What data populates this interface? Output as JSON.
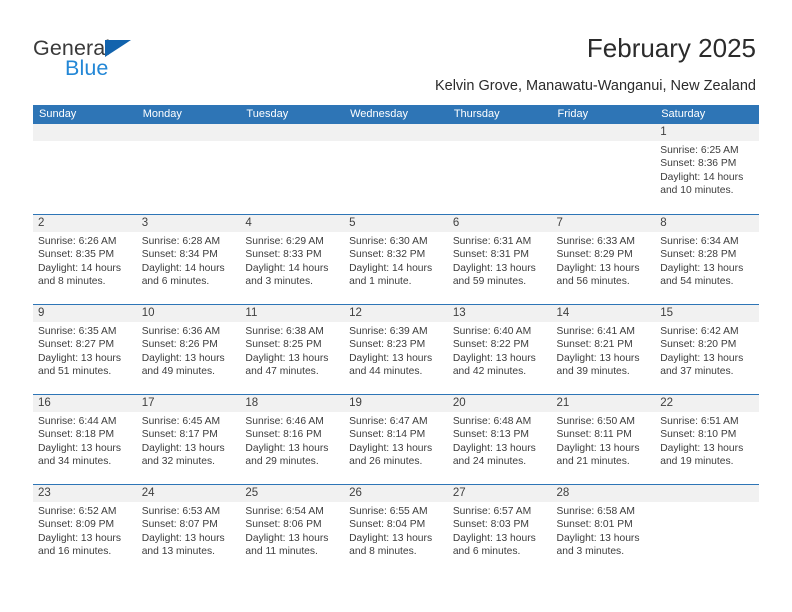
{
  "brand": {
    "name_part1": "General",
    "name_part2": "Blue",
    "triangle_icon": "triangle-icon",
    "primary_color": "#2e75b6",
    "accent_color": "#2387d6"
  },
  "header": {
    "title": "February 2025",
    "subtitle": "Kelvin Grove, Manawatu-Wanganui, New Zealand"
  },
  "calendar": {
    "day_headers": [
      "Sunday",
      "Monday",
      "Tuesday",
      "Wednesday",
      "Thursday",
      "Friday",
      "Saturday"
    ],
    "labels": {
      "sunrise": "Sunrise:",
      "sunset": "Sunset:",
      "daylight": "Daylight:"
    },
    "weeks": [
      [
        {
          "day": "",
          "sunrise": "",
          "sunset": "",
          "daylight_1": "",
          "daylight_2": ""
        },
        {
          "day": "",
          "sunrise": "",
          "sunset": "",
          "daylight_1": "",
          "daylight_2": ""
        },
        {
          "day": "",
          "sunrise": "",
          "sunset": "",
          "daylight_1": "",
          "daylight_2": ""
        },
        {
          "day": "",
          "sunrise": "",
          "sunset": "",
          "daylight_1": "",
          "daylight_2": ""
        },
        {
          "day": "",
          "sunrise": "",
          "sunset": "",
          "daylight_1": "",
          "daylight_2": ""
        },
        {
          "day": "",
          "sunrise": "",
          "sunset": "",
          "daylight_1": "",
          "daylight_2": ""
        },
        {
          "day": "1",
          "sunrise": "Sunrise: 6:25 AM",
          "sunset": "Sunset: 8:36 PM",
          "daylight_1": "Daylight: 14 hours",
          "daylight_2": "and 10 minutes."
        }
      ],
      [
        {
          "day": "2",
          "sunrise": "Sunrise: 6:26 AM",
          "sunset": "Sunset: 8:35 PM",
          "daylight_1": "Daylight: 14 hours",
          "daylight_2": "and 8 minutes."
        },
        {
          "day": "3",
          "sunrise": "Sunrise: 6:28 AM",
          "sunset": "Sunset: 8:34 PM",
          "daylight_1": "Daylight: 14 hours",
          "daylight_2": "and 6 minutes."
        },
        {
          "day": "4",
          "sunrise": "Sunrise: 6:29 AM",
          "sunset": "Sunset: 8:33 PM",
          "daylight_1": "Daylight: 14 hours",
          "daylight_2": "and 3 minutes."
        },
        {
          "day": "5",
          "sunrise": "Sunrise: 6:30 AM",
          "sunset": "Sunset: 8:32 PM",
          "daylight_1": "Daylight: 14 hours",
          "daylight_2": "and 1 minute."
        },
        {
          "day": "6",
          "sunrise": "Sunrise: 6:31 AM",
          "sunset": "Sunset: 8:31 PM",
          "daylight_1": "Daylight: 13 hours",
          "daylight_2": "and 59 minutes."
        },
        {
          "day": "7",
          "sunrise": "Sunrise: 6:33 AM",
          "sunset": "Sunset: 8:29 PM",
          "daylight_1": "Daylight: 13 hours",
          "daylight_2": "and 56 minutes."
        },
        {
          "day": "8",
          "sunrise": "Sunrise: 6:34 AM",
          "sunset": "Sunset: 8:28 PM",
          "daylight_1": "Daylight: 13 hours",
          "daylight_2": "and 54 minutes."
        }
      ],
      [
        {
          "day": "9",
          "sunrise": "Sunrise: 6:35 AM",
          "sunset": "Sunset: 8:27 PM",
          "daylight_1": "Daylight: 13 hours",
          "daylight_2": "and 51 minutes."
        },
        {
          "day": "10",
          "sunrise": "Sunrise: 6:36 AM",
          "sunset": "Sunset: 8:26 PM",
          "daylight_1": "Daylight: 13 hours",
          "daylight_2": "and 49 minutes."
        },
        {
          "day": "11",
          "sunrise": "Sunrise: 6:38 AM",
          "sunset": "Sunset: 8:25 PM",
          "daylight_1": "Daylight: 13 hours",
          "daylight_2": "and 47 minutes."
        },
        {
          "day": "12",
          "sunrise": "Sunrise: 6:39 AM",
          "sunset": "Sunset: 8:23 PM",
          "daylight_1": "Daylight: 13 hours",
          "daylight_2": "and 44 minutes."
        },
        {
          "day": "13",
          "sunrise": "Sunrise: 6:40 AM",
          "sunset": "Sunset: 8:22 PM",
          "daylight_1": "Daylight: 13 hours",
          "daylight_2": "and 42 minutes."
        },
        {
          "day": "14",
          "sunrise": "Sunrise: 6:41 AM",
          "sunset": "Sunset: 8:21 PM",
          "daylight_1": "Daylight: 13 hours",
          "daylight_2": "and 39 minutes."
        },
        {
          "day": "15",
          "sunrise": "Sunrise: 6:42 AM",
          "sunset": "Sunset: 8:20 PM",
          "daylight_1": "Daylight: 13 hours",
          "daylight_2": "and 37 minutes."
        }
      ],
      [
        {
          "day": "16",
          "sunrise": "Sunrise: 6:44 AM",
          "sunset": "Sunset: 8:18 PM",
          "daylight_1": "Daylight: 13 hours",
          "daylight_2": "and 34 minutes."
        },
        {
          "day": "17",
          "sunrise": "Sunrise: 6:45 AM",
          "sunset": "Sunset: 8:17 PM",
          "daylight_1": "Daylight: 13 hours",
          "daylight_2": "and 32 minutes."
        },
        {
          "day": "18",
          "sunrise": "Sunrise: 6:46 AM",
          "sunset": "Sunset: 8:16 PM",
          "daylight_1": "Daylight: 13 hours",
          "daylight_2": "and 29 minutes."
        },
        {
          "day": "19",
          "sunrise": "Sunrise: 6:47 AM",
          "sunset": "Sunset: 8:14 PM",
          "daylight_1": "Daylight: 13 hours",
          "daylight_2": "and 26 minutes."
        },
        {
          "day": "20",
          "sunrise": "Sunrise: 6:48 AM",
          "sunset": "Sunset: 8:13 PM",
          "daylight_1": "Daylight: 13 hours",
          "daylight_2": "and 24 minutes."
        },
        {
          "day": "21",
          "sunrise": "Sunrise: 6:50 AM",
          "sunset": "Sunset: 8:11 PM",
          "daylight_1": "Daylight: 13 hours",
          "daylight_2": "and 21 minutes."
        },
        {
          "day": "22",
          "sunrise": "Sunrise: 6:51 AM",
          "sunset": "Sunset: 8:10 PM",
          "daylight_1": "Daylight: 13 hours",
          "daylight_2": "and 19 minutes."
        }
      ],
      [
        {
          "day": "23",
          "sunrise": "Sunrise: 6:52 AM",
          "sunset": "Sunset: 8:09 PM",
          "daylight_1": "Daylight: 13 hours",
          "daylight_2": "and 16 minutes."
        },
        {
          "day": "24",
          "sunrise": "Sunrise: 6:53 AM",
          "sunset": "Sunset: 8:07 PM",
          "daylight_1": "Daylight: 13 hours",
          "daylight_2": "and 13 minutes."
        },
        {
          "day": "25",
          "sunrise": "Sunrise: 6:54 AM",
          "sunset": "Sunset: 8:06 PM",
          "daylight_1": "Daylight: 13 hours",
          "daylight_2": "and 11 minutes."
        },
        {
          "day": "26",
          "sunrise": "Sunrise: 6:55 AM",
          "sunset": "Sunset: 8:04 PM",
          "daylight_1": "Daylight: 13 hours",
          "daylight_2": "and 8 minutes."
        },
        {
          "day": "27",
          "sunrise": "Sunrise: 6:57 AM",
          "sunset": "Sunset: 8:03 PM",
          "daylight_1": "Daylight: 13 hours",
          "daylight_2": "and 6 minutes."
        },
        {
          "day": "28",
          "sunrise": "Sunrise: 6:58 AM",
          "sunset": "Sunset: 8:01 PM",
          "daylight_1": "Daylight: 13 hours",
          "daylight_2": "and 3 minutes."
        },
        {
          "day": "",
          "sunrise": "",
          "sunset": "",
          "daylight_1": "",
          "daylight_2": ""
        }
      ]
    ]
  }
}
